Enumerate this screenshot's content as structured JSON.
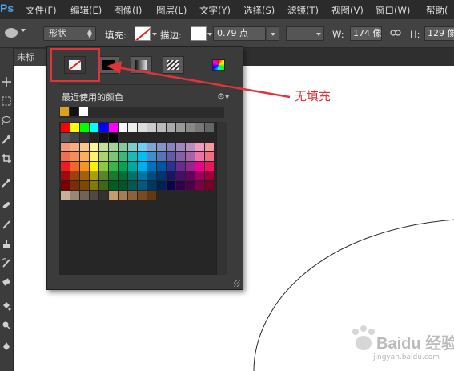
{
  "menubar": {
    "logo": "Ps",
    "items": [
      "文件(F)",
      "编辑(E)",
      "图像(I)",
      "图层(L)",
      "文字(Y)",
      "选择(S)",
      "滤镜(T)",
      "视图(V)",
      "窗口(W)",
      "帮助("
    ]
  },
  "options": {
    "tool_preset_icon": "ellipse-icon",
    "mode_value": "形状",
    "fill_label": "填充:",
    "stroke_label": "描边:",
    "stroke_width_value": "0.79 点",
    "width_label": "W:",
    "width_value": "174 像",
    "link_icon": "link-icon",
    "height_label": "H:",
    "height_value": "129 像"
  },
  "document": {
    "tab_label": "未标"
  },
  "swatch_panel": {
    "fill_types": [
      {
        "name": "no-fill",
        "icon": "no-fill-icon"
      },
      {
        "name": "solid-color",
        "icon": "solid-color-icon"
      },
      {
        "name": "gradient",
        "icon": "gradient-icon"
      },
      {
        "name": "pattern",
        "icon": "pattern-icon"
      }
    ],
    "color_picker_icon": "color-picker-icon",
    "recent_label": "最近使用的颜色",
    "settings_icon": "gear-icon",
    "recent_colors": [
      "#d9a418",
      "#111111",
      "#ffffff"
    ],
    "grid_rows": [
      [
        "#ff0000",
        "#ffff00",
        "#00ff00",
        "#00ffff",
        "#0000ff",
        "#ff00ff",
        "#ffffff",
        "#eeeeee",
        "#dddddd",
        "#cccccc",
        "#bbbbbb",
        "#aaaaaa",
        "#999999",
        "#888888",
        "#777777",
        "#666666"
      ],
      [
        "#555555",
        "#444444",
        "#333333",
        "#222222",
        "#111111",
        "#000000"
      ],
      [
        "#f7977a",
        "#f9ad81",
        "#fdc68a",
        "#fff79a",
        "#c4df9b",
        "#a2d39c",
        "#82ca9d",
        "#7bcdc8",
        "#6ecff6",
        "#7ea7d8",
        "#8493ca",
        "#8882be",
        "#a187be",
        "#bc8dbf",
        "#f49ac2",
        "#f6989d"
      ],
      [
        "#f26c4f",
        "#f68e55",
        "#fbaf5c",
        "#fff467",
        "#acd372",
        "#7cc576",
        "#3bb878",
        "#1abbb4",
        "#00bff3",
        "#438ccb",
        "#5574b9",
        "#605ca8",
        "#855fa8",
        "#a763a8",
        "#f06ea9",
        "#f26d7d"
      ],
      [
        "#ed1c24",
        "#f26522",
        "#f7941d",
        "#fff200",
        "#8dc63f",
        "#39b54a",
        "#00a651",
        "#00a99d",
        "#00aeef",
        "#0072bc",
        "#0054a6",
        "#2e3192",
        "#662d91",
        "#92278f",
        "#ec008c",
        "#ed145b"
      ],
      [
        "#9e0b0f",
        "#a0410d",
        "#a3620a",
        "#aba000",
        "#598527",
        "#1a7b30",
        "#007236",
        "#00746b",
        "#0076a3",
        "#004b80",
        "#003471",
        "#1b1464",
        "#440e62",
        "#630460",
        "#9e005d",
        "#9e0039"
      ],
      [
        "#790000",
        "#7b2e00",
        "#7d4900",
        "#827b00",
        "#406618",
        "#005e20",
        "#005826",
        "#005952",
        "#005b7f",
        "#003663",
        "#002157",
        "#0d004c",
        "#32004b",
        "#4b0049",
        "#7b0046",
        "#7a0026"
      ],
      [
        "#c7b299",
        "#998675",
        "#736357",
        "#534741",
        "#37302d",
        "#c69c6d",
        "#a67c52",
        "#8c6239",
        "#754c24",
        "#603913"
      ]
    ]
  },
  "annotation": {
    "text": "无填充"
  },
  "watermark": {
    "text": "Baidu 经验",
    "url": "jingyan.baidu.com"
  }
}
